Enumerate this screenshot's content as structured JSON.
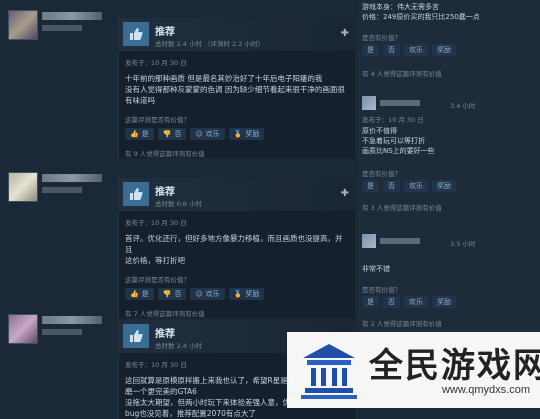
{
  "common": {
    "recommended": "推荐",
    "helpful_q": "这篇评测是否有价值？",
    "yes": "是",
    "no": "否",
    "funny": "欢乐",
    "award": "奖励",
    "add_icon": "plus-icon"
  },
  "reviews": [
    {
      "hours": "总时数 2.4 小时 （评测时 2.2 小时）",
      "date": "发布于：10 月 30 日",
      "lines": [
        "十年前的那种画质 但是最名其妙治好了十年后电子阳痿的我",
        "没有人觉得那种灰蒙蒙的色调 因为缺少细节看起来很干净的画面很",
        "有味道吗"
      ],
      "votes": "有 9 人觉得这篇评测有价值"
    },
    {
      "hours": "总时数 0.6 小时",
      "date": "发布于：10 月 30 日",
      "lines": [
        "首评。优化还行，但好多地方像暴力移植，而且画质也没提高，并且",
        "这价格，等打折吧"
      ],
      "votes": "有 7 人觉得这篇评测有价值"
    },
    {
      "hours": "总时数 2.4 小时",
      "date": "发布于：10 月 30 日",
      "lines": [
        "这回就算是原模原样搬上来我也认了，希望R星是拿",
        "磨一个更完美的GTA6",
        "没拖太大期望，但两小时玩下来体验差强人意，优化",
        "bug也没见着，推荐配置2070有点大了"
      ]
    }
  ],
  "sidebar": {
    "top_lines": [
      "游戏本身：伟大无需多言",
      "价格：249原价买的我只比250蠢一点"
    ],
    "helpful_q": "是否有价值？",
    "top_votes": "有 4 人觉得这篇评测有价值",
    "mid_hours": "3.4 小时",
    "mid_date": "发布于：10 月 30 日",
    "mid_lines": [
      "原价不值得",
      "不急着玩可以等打折",
      "画质比NS上的要好一些"
    ],
    "mid_votes": "有 3 人觉得这篇评测有价值",
    "low_hours": "3.5 小时",
    "low_line": "非常不错",
    "low_votes": "有 2 人觉得这篇评测有价值"
  },
  "watermark": {
    "title": "全民游戏网",
    "url": "www.qmydxs.com"
  },
  "colors": {
    "bg": "#1b2838",
    "thumb": "#3b6e94"
  }
}
